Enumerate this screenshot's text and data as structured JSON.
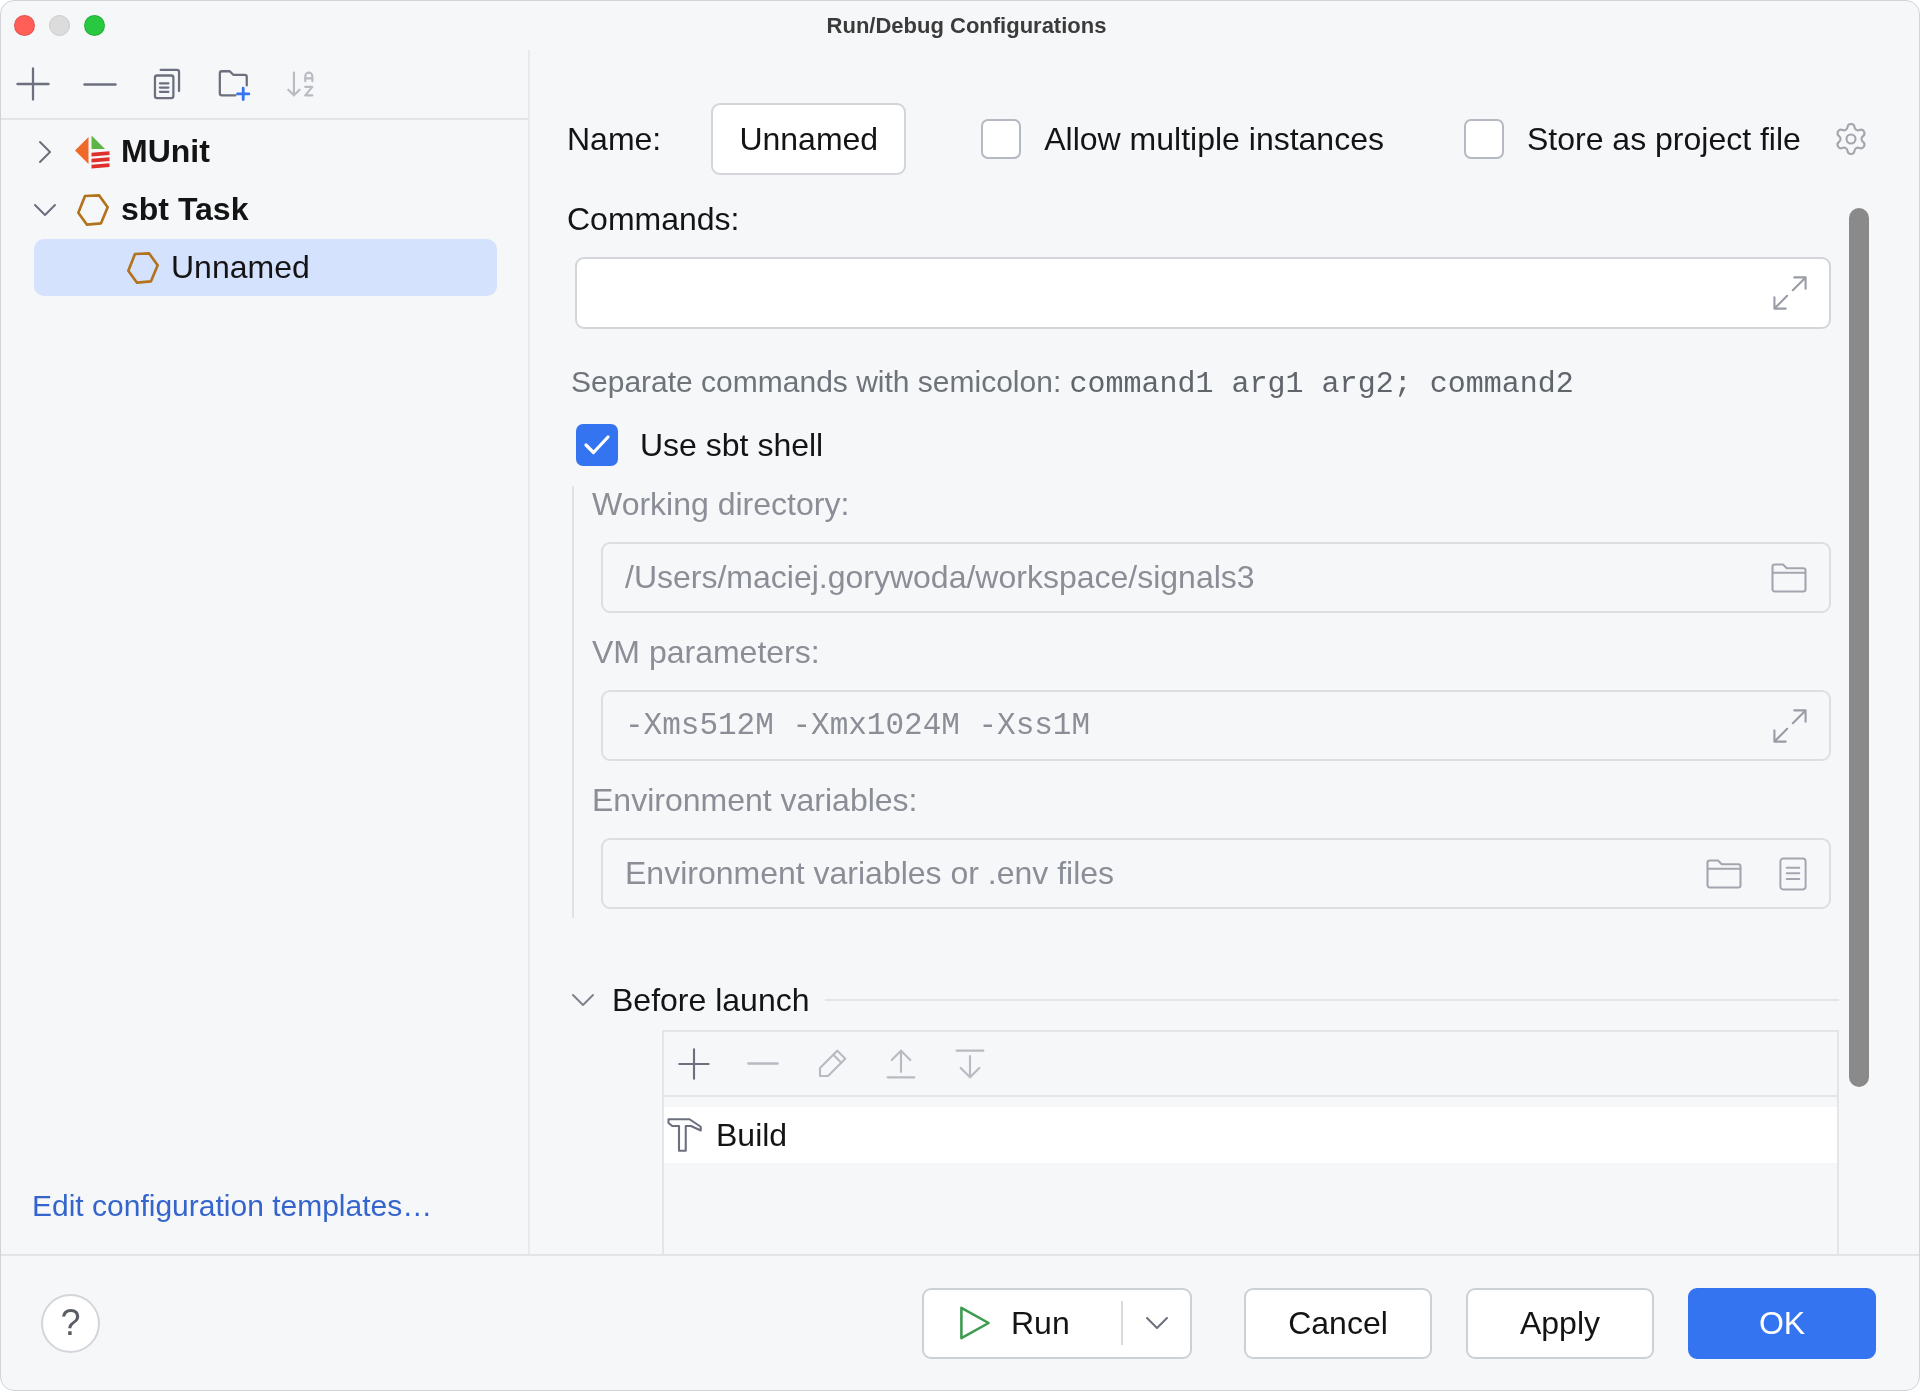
{
  "window": {
    "title": "Run/Debug Configurations",
    "controls": [
      {
        "kind": "close",
        "disabled": false
      },
      {
        "kind": "minimize",
        "disabled": true
      },
      {
        "kind": "zoom",
        "disabled": false
      }
    ]
  },
  "sidebar": {
    "toolbar": [
      {
        "kind": "add",
        "disabled": false
      },
      {
        "kind": "remove",
        "disabled": false
      },
      {
        "kind": "copy",
        "disabled": false
      },
      {
        "kind": "new_folder",
        "disabled": false
      },
      {
        "kind": "sort",
        "disabled": true
      }
    ],
    "tree": [
      {
        "label": "MUnit",
        "kind": "munit",
        "expanded": false,
        "selected": false
      },
      {
        "label": "sbt Task",
        "kind": "sbt",
        "expanded": true,
        "selected": false,
        "children": [
          {
            "label": "Unnamed",
            "kind": "sbt",
            "selected": true
          }
        ]
      }
    ],
    "templates_link": "Edit configuration templates…"
  },
  "form": {
    "name": {
      "label": "Name:",
      "value": "Unnamed"
    },
    "options": [
      {
        "label": "Allow multiple instances",
        "checked": false
      },
      {
        "label": "Store as project file",
        "checked": false
      }
    ],
    "commands": {
      "label": "Commands:"
    },
    "hint": {
      "text": "Separate commands with semicolon:",
      "example": "command1 arg1 arg2; command2"
    },
    "use_sbt_shell": {
      "label": "Use sbt shell",
      "checked": true
    },
    "shell_settings": {
      "disabled": true,
      "fields": [
        {
          "kind": "path",
          "label": "Working directory:",
          "value": "/Users/maciej.gorywoda/workspace/signals3"
        },
        {
          "kind": "jvm",
          "label": "VM parameters:",
          "value": "-Xms512M -Xmx1024M -Xss1M"
        },
        {
          "kind": "env",
          "label": "Environment variables:",
          "placeholder": "Environment variables or .env files"
        }
      ]
    },
    "before_launch": {
      "title": "Before launch",
      "expanded": true,
      "toolbar": [
        {
          "kind": "add",
          "disabled": false
        },
        {
          "kind": "remove",
          "disabled": true
        },
        {
          "kind": "edit",
          "disabled": true
        },
        {
          "kind": "move_up",
          "disabled": true
        },
        {
          "kind": "move_down",
          "disabled": true
        }
      ],
      "tasks": [
        {
          "label": "Build"
        }
      ]
    }
  },
  "footer": {
    "help": "?",
    "buttons": [
      {
        "label": "Run",
        "kind": "split"
      },
      {
        "label": "Cancel",
        "kind": "default"
      },
      {
        "label": "Apply",
        "kind": "default"
      },
      {
        "label": "OK",
        "kind": "primary"
      }
    ]
  }
}
